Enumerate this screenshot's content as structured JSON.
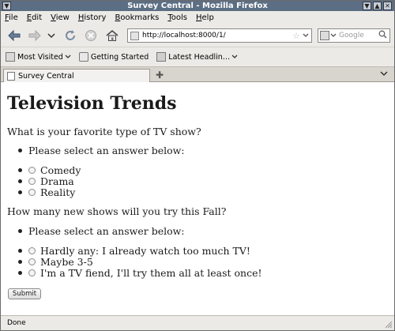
{
  "window": {
    "title": "Survey Central - Mozilla Firefox"
  },
  "menubar": {
    "items": [
      {
        "acc": "F",
        "rest": "ile"
      },
      {
        "acc": "E",
        "rest": "dit"
      },
      {
        "acc": "V",
        "rest": "iew"
      },
      {
        "acc": "H",
        "rest": "istory"
      },
      {
        "acc": "B",
        "rest": "ookmarks"
      },
      {
        "acc": "T",
        "rest": "ools"
      },
      {
        "acc": "H",
        "rest": "elp"
      }
    ]
  },
  "navbar": {
    "url": "http://localhost:8000/1/",
    "search_placeholder": "Google",
    "icons": [
      "back-icon",
      "forward-icon",
      "history-dropdown-icon",
      "reload-icon",
      "stop-icon",
      "home-icon",
      "site-identity-icon",
      "bookmark-star-icon",
      "search-engine-icon",
      "search-icon"
    ]
  },
  "bookmarks": {
    "items": [
      "Most Visited",
      "Getting Started",
      "Latest Headlin…"
    ]
  },
  "tabs": {
    "active_label": "Survey Central"
  },
  "page": {
    "heading": "Television Trends",
    "questions": [
      {
        "text": "What is your favorite type of TV show?",
        "prompt": "Please select an answer below:",
        "options": [
          "Comedy",
          "Drama",
          "Reality"
        ]
      },
      {
        "text": "How many new shows will you try this Fall?",
        "prompt": "Please select an answer below:",
        "options": [
          "Hardly any: I already watch too much TV!",
          "Maybe 3-5",
          "I'm a TV fiend, I'll try them all at least once!"
        ]
      }
    ],
    "submit_label": "Submit"
  },
  "status": {
    "text": "Done"
  },
  "colors": {
    "titlebar": "#5c6e84",
    "chrome": "#eceae6",
    "content_bg": "#ffffff"
  }
}
